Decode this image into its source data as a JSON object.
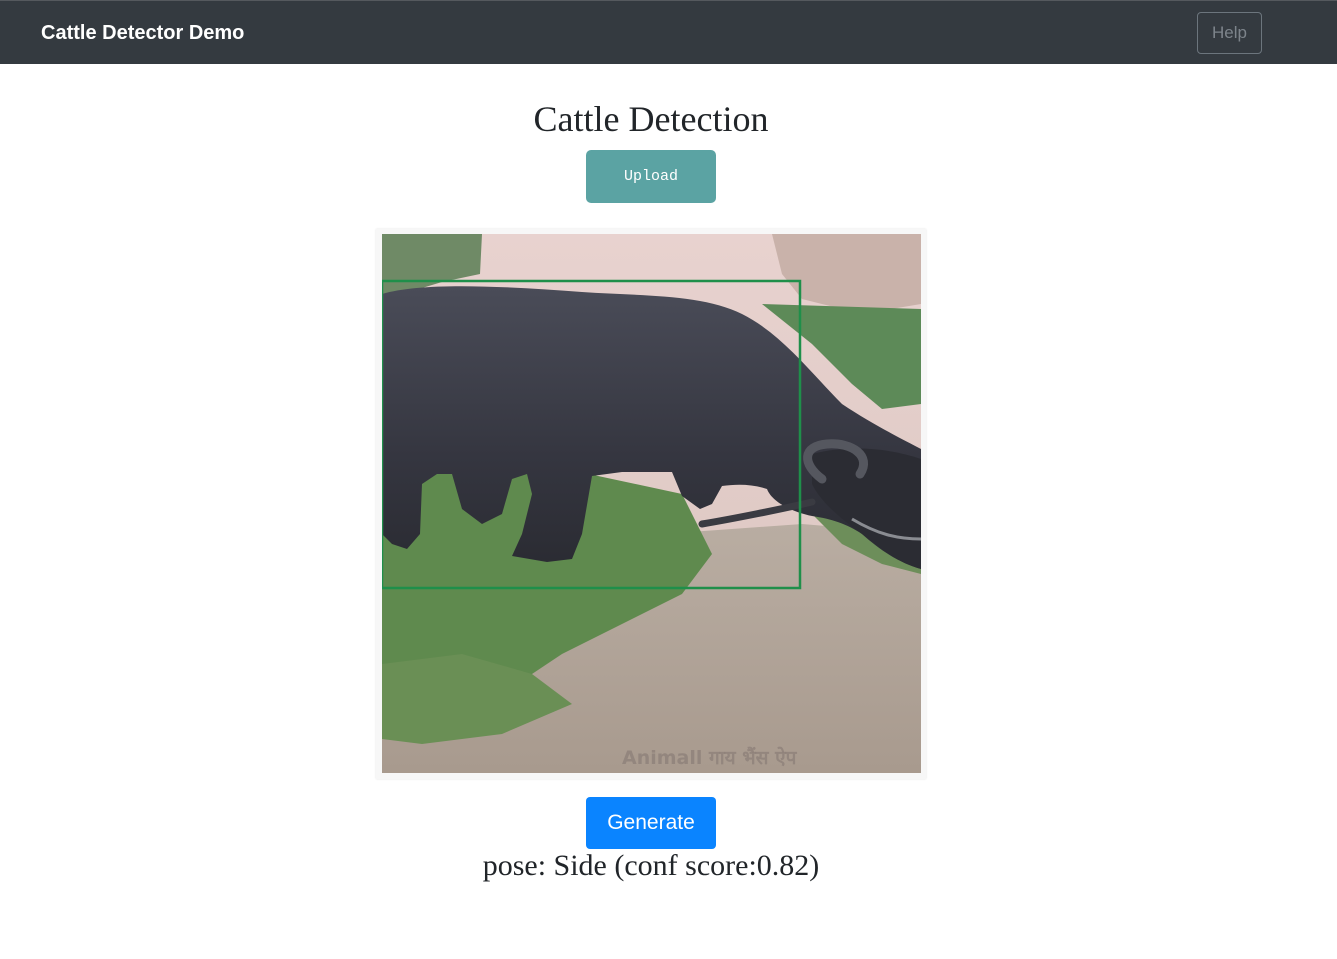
{
  "navbar": {
    "brand": "Cattle Detector Demo",
    "help_label": "Help"
  },
  "main": {
    "title": "Cattle Detection",
    "upload_label": "Upload",
    "image": {
      "subject": "water buffalo grazing with detection box",
      "watermark": "Animall गाय भैंस ऐप"
    },
    "generate_label": "Generate",
    "result_text": "pose: Side (conf score:0.82)"
  },
  "colors": {
    "navbar_bg": "#343a40",
    "upload_bg": "#5ba3a3",
    "generate_bg": "#0a84ff",
    "bbox": "#1f8f4a"
  }
}
